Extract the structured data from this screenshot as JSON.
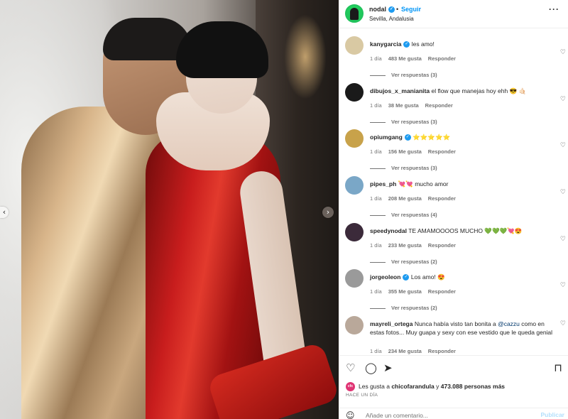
{
  "post": {
    "username": "nodal",
    "follow_label": "Seguir",
    "location": "Sevilla, Andalusia",
    "more_label": "···"
  },
  "photo": {
    "prev_label": "‹",
    "next_label": "›"
  },
  "comments": [
    {
      "user": "kanygarcia",
      "verified": true,
      "text": "les amo!",
      "time": "1 día",
      "likes": "483 Me gusta",
      "reply": "Responder",
      "view_replies": "Ver respuestas (3)",
      "avatar_color": "#d9c9a3"
    },
    {
      "user": "dibujos_x_manianita",
      "verified": false,
      "text": "el flow que manejas hoy ehh 😎 🤙🏻",
      "time": "1 día",
      "likes": "38 Me gusta",
      "reply": "Responder",
      "view_replies": "Ver respuestas (3)",
      "avatar_color": "#1a1a1a"
    },
    {
      "user": "opiumgang",
      "verified": true,
      "text": "⭐⭐⭐⭐⭐",
      "time": "1 día",
      "likes": "156 Me gusta",
      "reply": "Responder",
      "view_replies": "Ver respuestas (3)",
      "avatar_color": "#c8a24a"
    },
    {
      "user": "pipes_ph",
      "verified": false,
      "text": "💘💘 mucho amor",
      "time": "1 día",
      "likes": "208 Me gusta",
      "reply": "Responder",
      "view_replies": "Ver respuestas (4)",
      "avatar_color": "#7aa7c7"
    },
    {
      "user": "speedynodal",
      "verified": false,
      "text": "TE AMAMOOOOS MUCHO 💚💚💚💘😍",
      "time": "1 día",
      "likes": "233 Me gusta",
      "reply": "Responder",
      "view_replies": "Ver respuestas (2)",
      "avatar_color": "#3b2a3a"
    },
    {
      "user": "jorgeoleon",
      "verified": true,
      "text": "Los amo! 😍",
      "time": "1 día",
      "likes": "355 Me gusta",
      "reply": "Responder",
      "view_replies": "Ver respuestas (2)",
      "avatar_color": "#9a9a9a"
    },
    {
      "user": "mayreli_ortega",
      "verified": false,
      "text": "Nunca había visto tan bonita a ",
      "mention": "@cazzu",
      "text_after": " como en estas fotos... Muy guapa y sexy con ese vestido que le queda genial",
      "time": "1 día",
      "likes": "234 Me gusta",
      "reply": "Responder",
      "view_replies": "",
      "avatar_color": "#b9a89a"
    }
  ],
  "actions": {
    "like_icon": "heart-icon",
    "comment_icon": "comment-icon",
    "share_icon": "share-icon",
    "save_icon": "bookmark-icon",
    "likes_avatar_label": "cfc",
    "likes_prefix": "Les gusta a ",
    "likes_user": "chicofarandula",
    "likes_middle": " y ",
    "likes_count": "473.088 personas más",
    "date": "HACE UN DÍA",
    "comment_placeholder": "Añade un comentario...",
    "publish_label": "Publicar"
  }
}
